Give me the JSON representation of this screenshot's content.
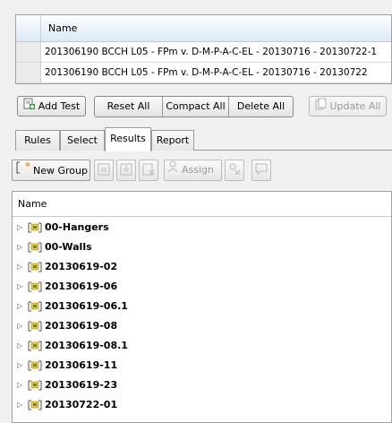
{
  "tests_table": {
    "column_name": "Name",
    "rows": [
      "201306190 BCCH L05 - FPm v. D-M-P-A-C-EL - 20130716 - 20130722-1",
      "201306190 BCCH L05 - FPm v. D-M-P-A-C-EL - 20130716 - 20130722"
    ]
  },
  "toolbar": {
    "add_test": "Add Test",
    "reset_all": "Reset All",
    "compact_all": "Compact All",
    "delete_all": "Delete All",
    "update_all": "Update All"
  },
  "tabs": [
    {
      "label": "Rules",
      "active": false
    },
    {
      "label": "Select",
      "active": false
    },
    {
      "label": "Results",
      "active": true
    },
    {
      "label": "Report",
      "active": false
    }
  ],
  "results_toolbar": {
    "new_group": "New Group",
    "assign": "Assign"
  },
  "tree": {
    "column_name": "Name",
    "items": [
      "00-Hangers",
      "00-Walls",
      "20130619-02",
      "20130619-06",
      "20130619-06.1",
      "20130619-08",
      "20130619-08.1",
      "20130619-11",
      "20130619-23",
      "20130722-01"
    ]
  },
  "colors": {
    "folder_yellow": "#f2c23a",
    "folder_green": "#4a9a3a",
    "new_icon_orange": "#f08a1c"
  }
}
